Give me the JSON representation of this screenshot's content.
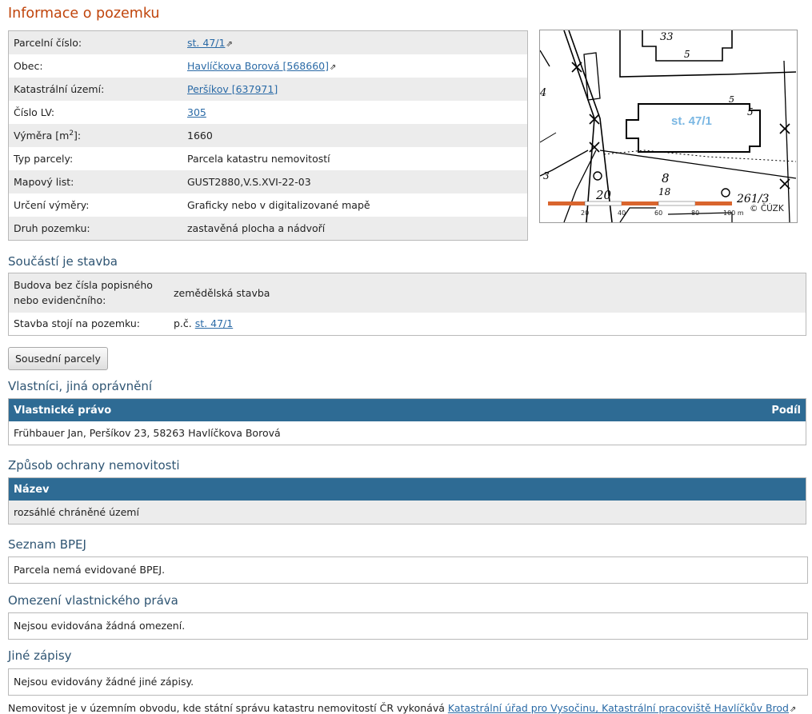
{
  "page_title": "Informace o pozemku",
  "parcel": {
    "rows": [
      {
        "label": "Parcelní číslo:",
        "value": "st. 47/1",
        "link": true,
        "external": true
      },
      {
        "label": "Obec:",
        "value": "Havlíčkova Borová [568660]",
        "link": true,
        "external": true
      },
      {
        "label": "Katastrální území:",
        "value": "Peršíkov [637971]",
        "link": true,
        "external": false
      },
      {
        "label": "Číslo LV:",
        "value": "305",
        "link": true,
        "external": false
      },
      {
        "label_prefix": "Výměra [m",
        "label_sup": "2",
        "label_suffix": "]:",
        "value": "1660"
      },
      {
        "label": "Typ parcely:",
        "value": "Parcela katastru nemovitostí"
      },
      {
        "label": "Mapový list:",
        "value": "GUST2880,V.S.XVI-22-03"
      },
      {
        "label": "Určení výměry:",
        "value": "Graficky nebo v digitalizované mapě"
      },
      {
        "label": "Druh pozemku:",
        "value": "zastavěná plocha a nádvoří"
      }
    ]
  },
  "map": {
    "parcel_label": "st. 47/1",
    "copyright": "© ČÚZK",
    "scale_labels": [
      "20",
      "40",
      "60",
      "80",
      "100 m"
    ],
    "handwritten": [
      "33",
      "5",
      "5",
      "5",
      "8",
      "20",
      "18",
      "261/3",
      "4",
      "3"
    ]
  },
  "stavba": {
    "heading": "Součástí je stavba",
    "row1_label": "Budova bez čísla popisného nebo evidenčního:",
    "row1_value": "zemědělská stavba",
    "row2_label": "Stavba stojí na pozemku:",
    "row2_prefix": "p.č.",
    "row2_link": "st. 47/1"
  },
  "neighbors_button": "Sousední parcely",
  "owners": {
    "heading": "Vlastníci, jiná oprávnění",
    "col1": "Vlastnické právo",
    "col2": "Podíl",
    "row": "Frühbauer Jan, Peršíkov 23, 58263 Havlíčkova Borová"
  },
  "protection": {
    "heading": "Způsob ochrany nemovitosti",
    "col": "Název",
    "row": "rozsáhlé chráněné území"
  },
  "bpej": {
    "heading": "Seznam BPEJ",
    "text": "Parcela nemá evidované BPEJ."
  },
  "restrictions": {
    "heading": "Omezení vlastnického práva",
    "text": "Nejsou evidována žádná omezení."
  },
  "other": {
    "heading": "Jiné zápisy",
    "text": "Nejsou evidovány žádné jiné zápisy."
  },
  "footer": {
    "text": "Nemovitost je v územním obvodu, kde státní správu katastru nemovitostí ČR vykonává ",
    "link": "Katastrální úřad pro Vysočinu, Katastrální pracoviště Havlíčkův Brod"
  }
}
